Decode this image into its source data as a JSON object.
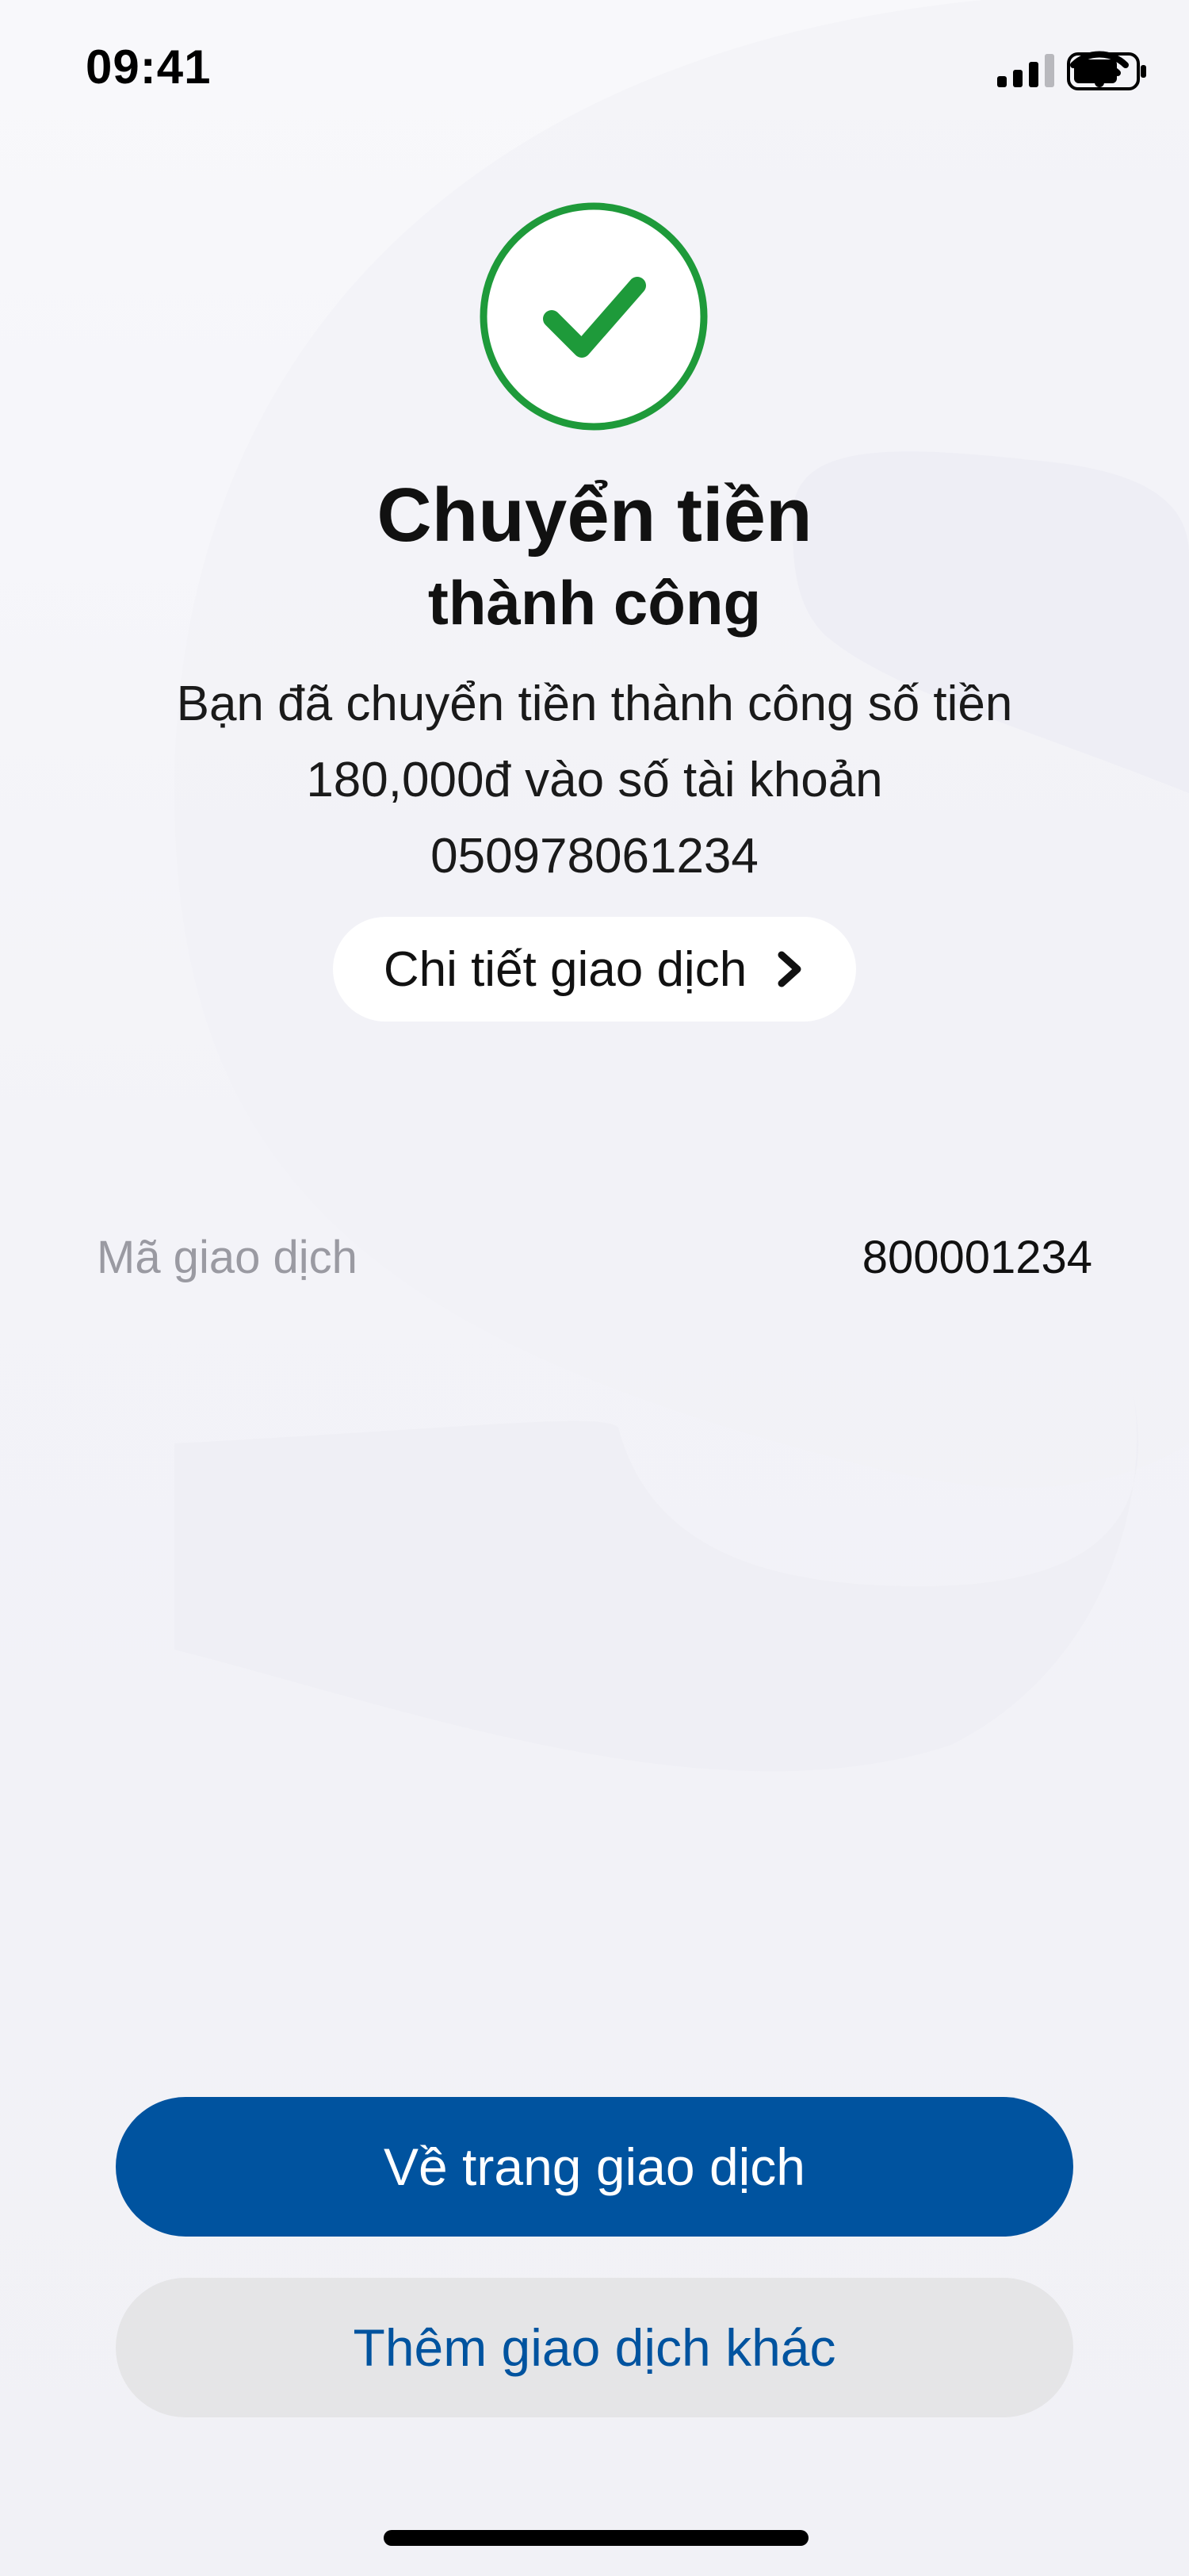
{
  "status_bar": {
    "time": "09:41",
    "icons": [
      "cellular-signal-icon",
      "wifi-icon",
      "battery-icon"
    ]
  },
  "success": {
    "icon": "checkmark-circle-icon",
    "title": "Chuyển tiền",
    "subtitle": "thành công",
    "message_lines": [
      "Bạn đã chuyển tiền thành công số tiền",
      "180,000đ vào số tài khoản",
      "050978061234"
    ],
    "details_link": "Chi tiết giao dịch"
  },
  "transaction": {
    "label": "Mã giao dịch",
    "value": "800001234"
  },
  "actions": {
    "primary": "Về trang giao dịch",
    "secondary": "Thêm giao dịch khác"
  },
  "colors": {
    "accent": "#00539f",
    "success": "#1e9a3a",
    "secondary_bg": "#e5e5e7"
  }
}
